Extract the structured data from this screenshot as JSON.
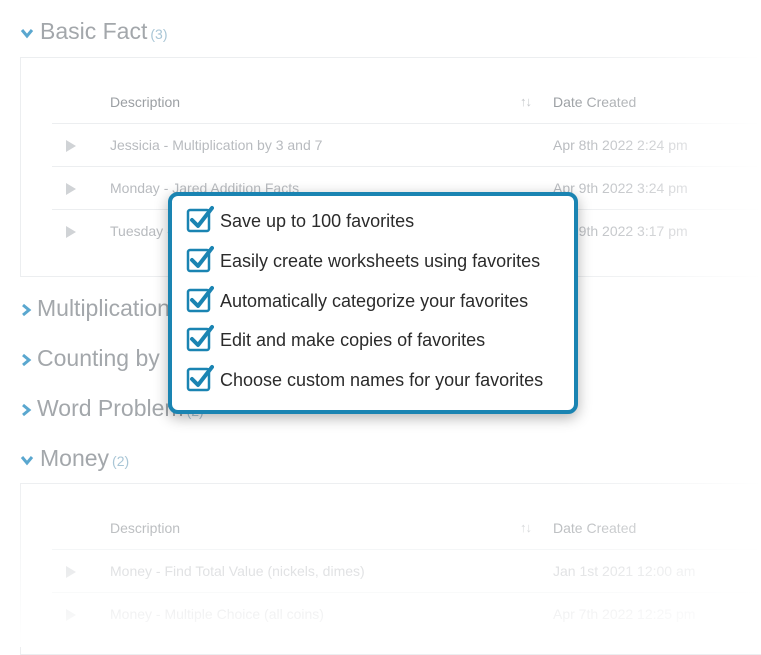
{
  "columns": {
    "description": "Description",
    "date_created": "Date Created",
    "sort_glyph": "↑↓"
  },
  "categories": [
    {
      "title": "Basic Fact",
      "count": "(3)",
      "expanded": true,
      "rows": [
        {
          "description": "Jessicia - Multiplication by 3 and 7",
          "date": "Apr 8th 2022 2:24 pm"
        },
        {
          "description": "Monday - Jared Addition Facts",
          "date": "Apr 9th 2022 3:24 pm"
        },
        {
          "description": "Tuesday - Jared",
          "date": "Apr 9th 2022 3:17 pm"
        }
      ]
    },
    {
      "title": "Multiplication",
      "count": "",
      "expanded": false
    },
    {
      "title": "Counting by",
      "count": "",
      "expanded": false
    },
    {
      "title": "Word Problem",
      "count": "(2)",
      "expanded": false
    },
    {
      "title": "Money",
      "count": "(2)",
      "expanded": true,
      "rows": [
        {
          "description": "Money - Find Total Value (nickels, dimes)",
          "date": "Jan 1st 2021 12:00 am"
        },
        {
          "description": "Money - Multiple Choice (all coins)",
          "date": "Apr 7th 2022 12:25 pm"
        }
      ]
    }
  ],
  "features": [
    "Save up to 100 favorites",
    "Easily create worksheets using favorites",
    "Automatically categorize your favorites",
    "Edit and make copies of favorites",
    "Choose custom names for your favorites"
  ],
  "colors": {
    "accent": "#1a84b2",
    "chevron": "#5aa7cf",
    "muted_text": "#a3a7ab"
  },
  "icons": {
    "expanded": "chevron-down-icon",
    "collapsed": "chevron-right-icon",
    "row": "play-icon",
    "feature": "checkbox-checked-icon"
  }
}
